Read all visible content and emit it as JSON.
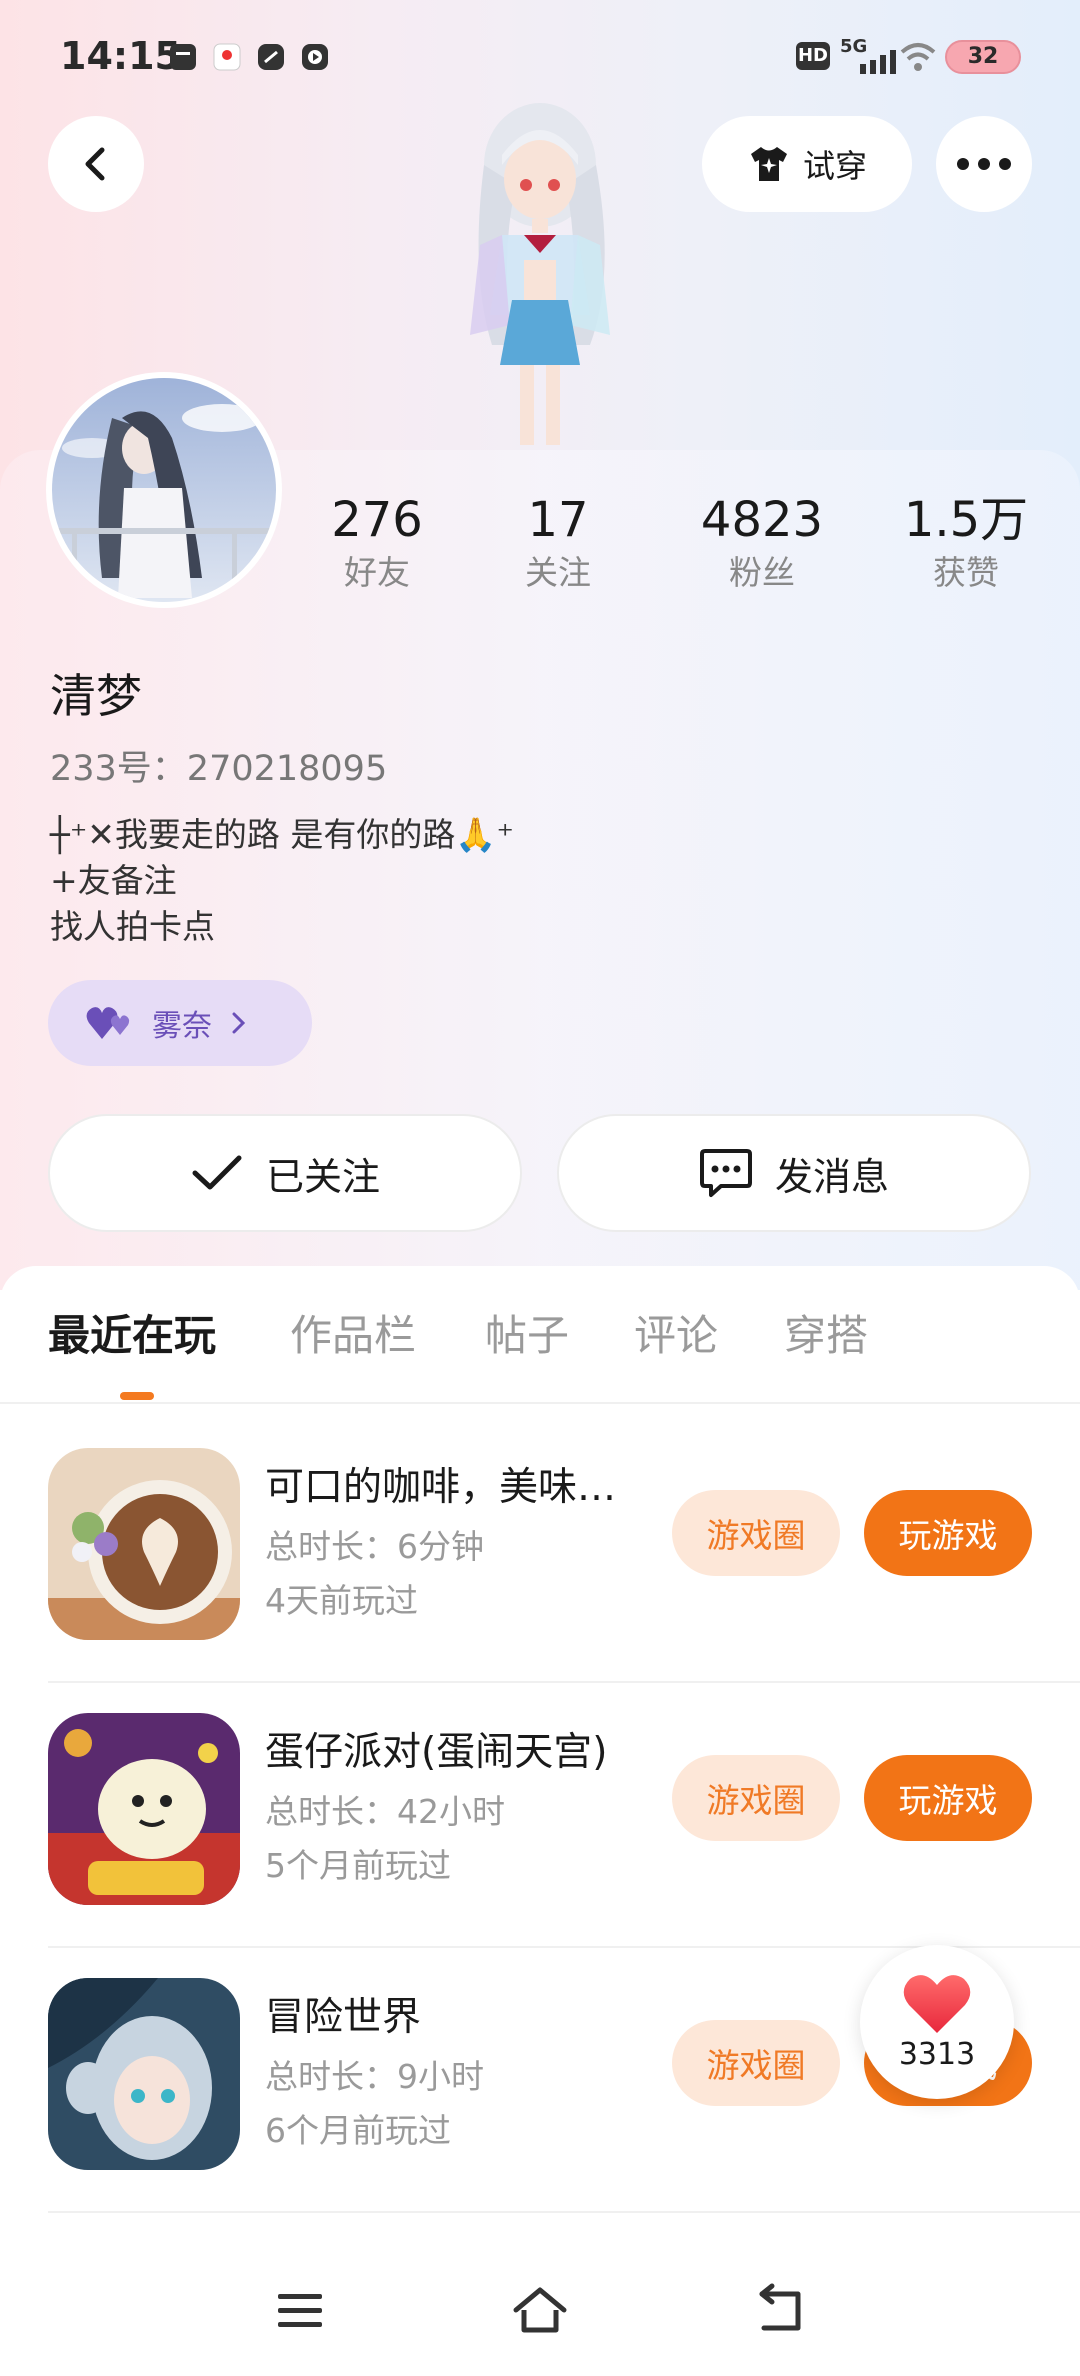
{
  "status_bar": {
    "time": "14:15",
    "network": "5G",
    "hd": "HD",
    "battery": "32"
  },
  "header": {
    "back_icon": "chevron-left-icon",
    "try_on_label": "试穿",
    "more_icon": "more-dots-icon"
  },
  "profile": {
    "name": "清梦",
    "uid_text": "233号：270218095",
    "bio_lines": [
      "┼⁺✕我要走的路 是有你的路🙏⁺",
      "+友备注",
      "找人拍卡点"
    ],
    "tag_label": "雾奈",
    "stats": [
      {
        "value": "276",
        "label": "好友"
      },
      {
        "value": "17",
        "label": "关注"
      },
      {
        "value": "4823",
        "label": "粉丝"
      },
      {
        "value": "1.5万",
        "label": "获赞"
      }
    ],
    "follow_label": "已关注",
    "message_label": "发消息"
  },
  "tabs": [
    "最近在玩",
    "作品栏",
    "帖子",
    "评论",
    "穿搭"
  ],
  "active_tab": "最近在玩",
  "games": [
    {
      "title": "可口的咖啡，美味…",
      "duration": "总时长：6分钟",
      "last_played": "4天前玩过",
      "circle_label": "游戏圈",
      "play_label": "玩游戏"
    },
    {
      "title": "蛋仔派对(蛋闹天宫)",
      "duration": "总时长：42小时",
      "last_played": "5个月前玩过",
      "circle_label": "游戏圈",
      "play_label": "玩游戏"
    },
    {
      "title": "冒险世界",
      "duration": "总时长：9小时",
      "last_played": "6个月前玩过",
      "circle_label": "游戏圈",
      "play_label": "玩游戏"
    }
  ],
  "likes": {
    "count": "3313"
  },
  "colors": {
    "accent_orange": "#f27416",
    "accent_orange_light": "#fde7d8",
    "tag_purple": "#6a4fb8",
    "tag_bg": "#e6dcf6"
  }
}
